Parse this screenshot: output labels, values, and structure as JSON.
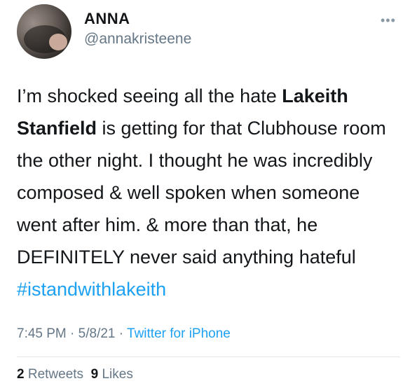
{
  "author": {
    "display_name": "ANNA",
    "handle": "@annakristeene"
  },
  "menu_icon": "more-dots-icon",
  "tweet": {
    "text_part1": "I’m shocked seeing all the hate ",
    "bold_name": "Lakeith Stanfield",
    "text_part2": " is getting for that Clubhouse room the other night. I thought he was incredibly composed & well spoken when someone went after him. & more than that, he DEFINITELY never said anything hateful ",
    "hashtag": "#istandwithlakeith"
  },
  "meta": {
    "time": "7:45 PM",
    "separator": " · ",
    "date": "5/8/21",
    "source": "Twitter for iPhone"
  },
  "stats": {
    "retweets_count": "2",
    "retweets_label": "Retweets",
    "likes_count": "9",
    "likes_label": "Likes"
  },
  "colors": {
    "link": "#1da1f2",
    "secondary": "#657786",
    "primary": "#14171a",
    "divider": "#e1e8ed"
  }
}
